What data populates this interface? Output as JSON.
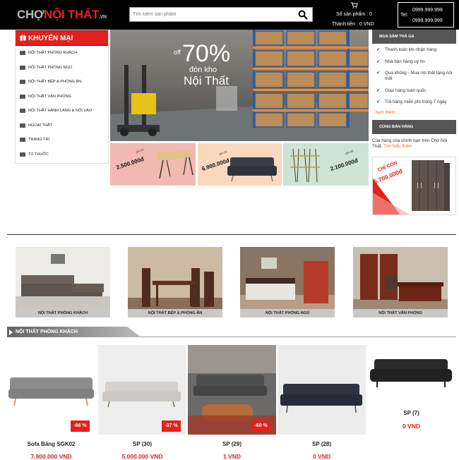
{
  "header": {
    "logo": {
      "part1": "CHỢ",
      "part2": "NỘI THẤT",
      "part3": ".VN"
    },
    "search": {
      "placeholder": "Tìm kiếm sản phẩm"
    },
    "cart": {
      "count_label": "Số sản phẩm : 0",
      "total_label": "Thành tiền : 0 VND"
    },
    "contact": {
      "tel_label": "Tel:",
      "phone_1": "0999.999.999",
      "phone_2": "0999.999.999"
    }
  },
  "menu": {
    "title": "KHUYẾN MẠI",
    "items": [
      {
        "label": "Nội thất phòng khách",
        "icon": "sofa-icon"
      },
      {
        "label": "Nội thất phòng ngủ",
        "icon": "bed-icon"
      },
      {
        "label": "Nội thất bếp & phòng ăn",
        "icon": "utensils-icon"
      },
      {
        "label": "Nội thất văn phòng",
        "icon": "office-chair-icon"
      },
      {
        "label": "Nội thất hành lang & nối vào",
        "icon": "door-icon"
      },
      {
        "label": "Ngoại thất",
        "icon": "garden-icon"
      },
      {
        "label": "Trang trí",
        "icon": "decor-icon"
      },
      {
        "label": "Tủ thuốc",
        "icon": "cabinet-icon"
      }
    ]
  },
  "banner": {
    "off_label": "off",
    "percent": "70%",
    "line1": "đón kho",
    "line2": "Nội Thất"
  },
  "promos": [
    {
      "price": "2.500.000đ",
      "label": "giá chỉ",
      "bg": "#f2b9b0"
    },
    {
      "price": "6.900.000đ",
      "label": "giá chỉ",
      "bg": "#f9d8bd"
    },
    {
      "price": "2.100.000đ",
      "label": "giá chỉ",
      "bg": "#cde3d3"
    }
  ],
  "sidebar": {
    "title": "MUA SẮM THẢ GA",
    "benefits": [
      "Thanh toán khi nhận hàng",
      "Nhà bán hàng uy tín",
      "Quá khủng - Mua nội thất tặng nội thất",
      "Giao hàng toàn quốc",
      "Trả hàng miễn phí trong 7 ngày"
    ],
    "more_label": "Xem thêm",
    "sell_title": "CÙNG BÁN HÀNG",
    "sell_desc": "Cùa hàng của chính bạn trên Chợ Nội Thất.",
    "sell_link": "Tìm hiểu thêm",
    "wardrobe_label": "CHỈ CÒN",
    "wardrobe_price": "5.700.000đ"
  },
  "categories": [
    {
      "label": "NỘI THẤT PHÒNG KHÁCH"
    },
    {
      "label": "NỘI THẤT BẾP & PHÒNG ĂN"
    },
    {
      "label": "NỘI THẤT PHÒNG NGỦ"
    },
    {
      "label": "NỘI THẤT VĂN PHÒNG"
    }
  ],
  "section": {
    "title": "NỘI THẤT PHÒNG KHÁCH"
  },
  "products": [
    {
      "name": "Sofa Băng SGK02",
      "price": "7.900.000 VND",
      "discount": "-66 %"
    },
    {
      "name": "SP (30)",
      "price": "5.000.000 VND",
      "discount": "-37 %"
    },
    {
      "name": "SP (29)",
      "price": "1 VND",
      "discount": "-60 %"
    },
    {
      "name": "SP (28)",
      "price": "0 VND",
      "discount": ""
    },
    {
      "name": "SP (7)",
      "price": "0 VND",
      "discount": ""
    }
  ],
  "colors": {
    "accent": "#e3211c",
    "header_bg": "#000000",
    "link": "#e8711d"
  }
}
